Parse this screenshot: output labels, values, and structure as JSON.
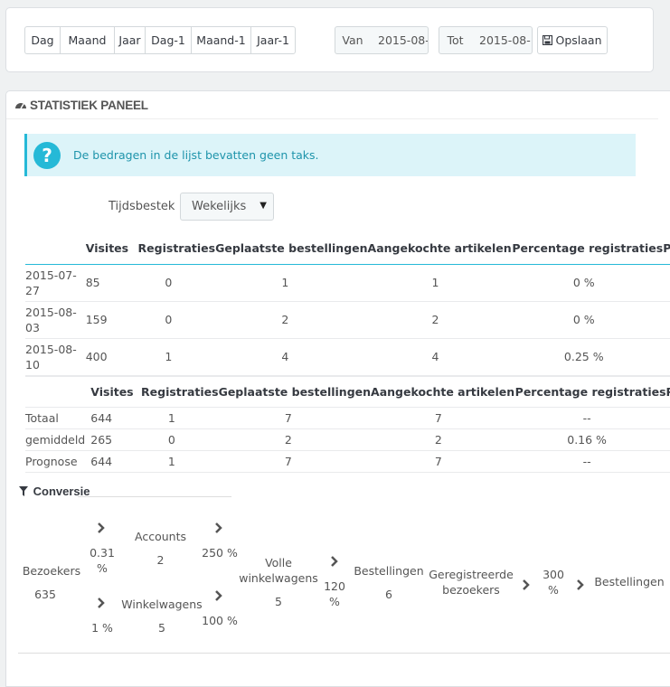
{
  "toolbar": {
    "periods": [
      "Dag",
      "Maand",
      "Jaar",
      "Dag-1",
      "Maand-1",
      "Jaar-1"
    ],
    "from_label": "Van",
    "from_value": "2015-08-",
    "to_label": "Tot",
    "to_value": "2015-08-",
    "save_label": "Opslaan"
  },
  "panel": {
    "title": "STATISTIEK PANEEL",
    "alert": "De bedragen in de lijst bevatten geen taks.",
    "interval_label": "Tijdsbestek",
    "interval_value": "Wekelijks"
  },
  "table": {
    "headers": [
      "Visites",
      "Registraties",
      "Geplaatste bestellingen",
      "Aangekochte artikelen",
      "Percentage registraties",
      "Pe"
    ],
    "rows": [
      {
        "date": "2015-07-27",
        "date1": "2015-07-",
        "date2": "27",
        "visits": "85",
        "reg": "0",
        "orders": "1",
        "items": "1",
        "pct": "0 %"
      },
      {
        "date": "2015-08-03",
        "date1": "2015-08-",
        "date2": "03",
        "visits": "159",
        "reg": "0",
        "orders": "2",
        "items": "2",
        "pct": "0 %"
      },
      {
        "date": "2015-08-10",
        "date1": "2015-08-",
        "date2": "10",
        "visits": "400",
        "reg": "1",
        "orders": "4",
        "items": "4",
        "pct": "0.25 %"
      }
    ]
  },
  "summary": {
    "headers": [
      "Visites",
      "Registraties",
      "Geplaatste bestellingen",
      "Aangekochte artikelen",
      "Percentage registraties",
      "Pe"
    ],
    "rows": [
      {
        "label": "Totaal",
        "visits": "644",
        "reg": "1",
        "orders": "7",
        "items": "7",
        "pct": "--"
      },
      {
        "label": "gemiddeld",
        "visits": "265",
        "reg": "0",
        "orders": "2",
        "items": "2",
        "pct": "0.16 %"
      },
      {
        "label": "Prognose",
        "visits": "644",
        "reg": "1",
        "orders": "7",
        "items": "7",
        "pct": "--"
      }
    ]
  },
  "conversion": {
    "title": "Conversie",
    "visitors_label": "Bezoekers",
    "visitors_value": "635",
    "rate_accounts": "0.31 %",
    "accounts_label": "Accounts",
    "accounts_value": "2",
    "rate_accounts_full": "250 %",
    "rate_carts": "1 %",
    "carts_label": "Winkelwagens",
    "carts_value": "5",
    "rate_carts_full": "100 %",
    "full_carts_label": "Volle winkelwagens",
    "full_carts_value": "5",
    "rate_orders": "120 %",
    "orders_label": "Bestellingen",
    "orders_value": "6",
    "registered_label": "Geregistreerde bezoekers",
    "rate_registered": "300 %",
    "orders2_label": "Bestellingen"
  }
}
